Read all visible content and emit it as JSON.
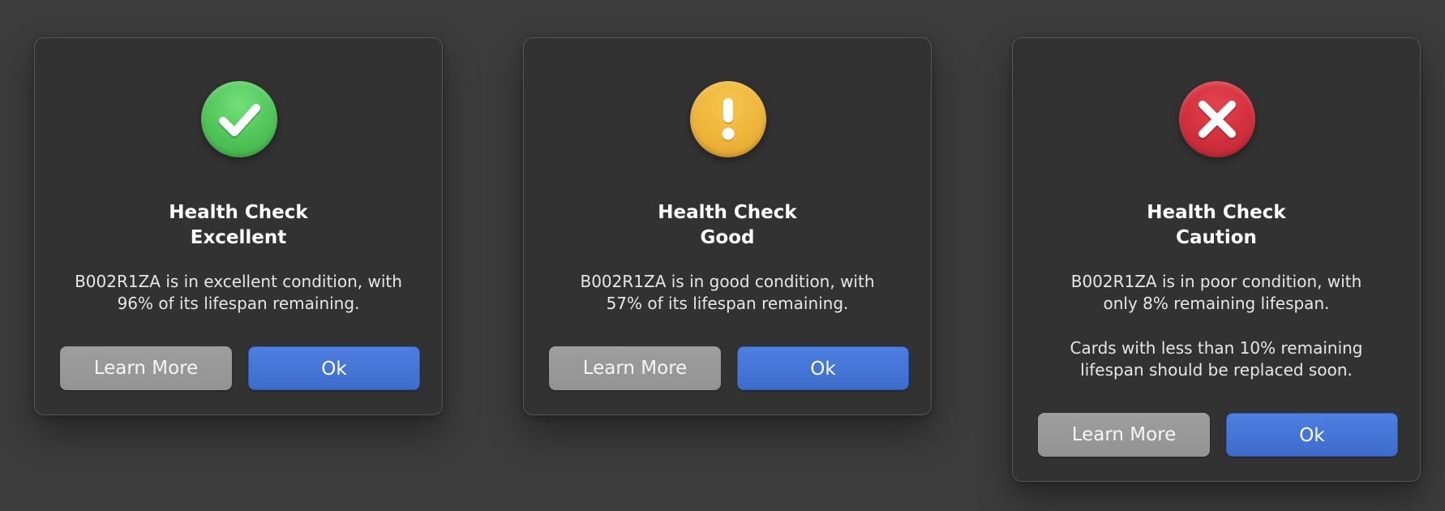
{
  "dialogs": [
    {
      "status": "excellent",
      "icon": "checkmark-icon",
      "icon_color": "#4fc457",
      "title_line1": "Health Check",
      "title_line2": "Excellent",
      "message_line1": "B002R1ZA is in excellent condition, with",
      "message_line2": "96% of its lifespan remaining.",
      "secondary_button": "Learn More",
      "primary_button": "Ok"
    },
    {
      "status": "good",
      "icon": "exclamation-icon",
      "icon_color": "#eeb43a",
      "title_line1": "Health Check",
      "title_line2": "Good",
      "message_line1": "B002R1ZA is in good condition, with",
      "message_line2": "57% of its lifespan remaining.",
      "secondary_button": "Learn More",
      "primary_button": "Ok"
    },
    {
      "status": "caution",
      "icon": "x-mark-icon",
      "icon_color": "#d22f3c",
      "title_line1": "Health Check",
      "title_line2": "Caution",
      "message_line1": "B002R1ZA is in poor condition, with",
      "message_line2": "only 8% remaining lifespan.",
      "note_line1": "Cards with less than 10% remaining",
      "note_line2": "lifespan should be replaced soon.",
      "secondary_button": "Learn More",
      "primary_button": "Ok"
    }
  ],
  "colors": {
    "background": "#3c3c3c",
    "dialog_background": "#323232",
    "primary_button": "#4575d6",
    "secondary_button": "#999999"
  }
}
